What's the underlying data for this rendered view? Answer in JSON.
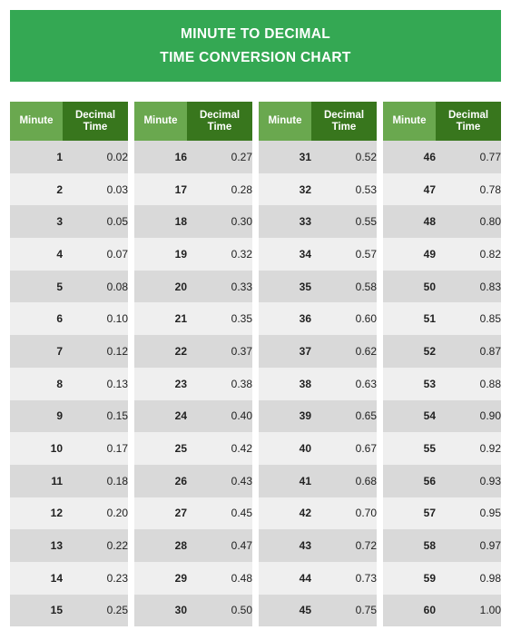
{
  "banner": {
    "title_line1": "MINUTE TO DECIMAL",
    "title_line2": "TIME CONVERSION CHART",
    "background_color": "#34a853",
    "text_color": "#ffffff"
  },
  "theme": {
    "header_minute_color": "#6aa84f",
    "header_decimal_color": "#38761d",
    "row_odd_color": "#d9d9d9",
    "row_even_color": "#efefef",
    "page_background": "#ffffff",
    "cell_text_color": "#222222"
  },
  "columns": {
    "minute_label": "Minute",
    "decimal_label_line1": "Decimal",
    "decimal_label_line2": "Time"
  },
  "chart_data": {
    "type": "table",
    "title": "MINUTE TO DECIMAL TIME CONVERSION CHART",
    "columns": [
      "Minute",
      "Decimal Time"
    ],
    "blocks": [
      {
        "rows": [
          {
            "minute": "1",
            "decimal": "0.02"
          },
          {
            "minute": "2",
            "decimal": "0.03"
          },
          {
            "minute": "3",
            "decimal": "0.05"
          },
          {
            "minute": "4",
            "decimal": "0.07"
          },
          {
            "minute": "5",
            "decimal": "0.08"
          },
          {
            "minute": "6",
            "decimal": "0.10"
          },
          {
            "minute": "7",
            "decimal": "0.12"
          },
          {
            "minute": "8",
            "decimal": "0.13"
          },
          {
            "minute": "9",
            "decimal": "0.15"
          },
          {
            "minute": "10",
            "decimal": "0.17"
          },
          {
            "minute": "11",
            "decimal": "0.18"
          },
          {
            "minute": "12",
            "decimal": "0.20"
          },
          {
            "minute": "13",
            "decimal": "0.22"
          },
          {
            "minute": "14",
            "decimal": "0.23"
          },
          {
            "minute": "15",
            "decimal": "0.25"
          }
        ]
      },
      {
        "rows": [
          {
            "minute": "16",
            "decimal": "0.27"
          },
          {
            "minute": "17",
            "decimal": "0.28"
          },
          {
            "minute": "18",
            "decimal": "0.30"
          },
          {
            "minute": "19",
            "decimal": "0.32"
          },
          {
            "minute": "20",
            "decimal": "0.33"
          },
          {
            "minute": "21",
            "decimal": "0.35"
          },
          {
            "minute": "22",
            "decimal": "0.37"
          },
          {
            "minute": "23",
            "decimal": "0.38"
          },
          {
            "minute": "24",
            "decimal": "0.40"
          },
          {
            "minute": "25",
            "decimal": "0.42"
          },
          {
            "minute": "26",
            "decimal": "0.43"
          },
          {
            "minute": "27",
            "decimal": "0.45"
          },
          {
            "minute": "28",
            "decimal": "0.47"
          },
          {
            "minute": "29",
            "decimal": "0.48"
          },
          {
            "minute": "30",
            "decimal": "0.50"
          }
        ]
      },
      {
        "rows": [
          {
            "minute": "31",
            "decimal": "0.52"
          },
          {
            "minute": "32",
            "decimal": "0.53"
          },
          {
            "minute": "33",
            "decimal": "0.55"
          },
          {
            "minute": "34",
            "decimal": "0.57"
          },
          {
            "minute": "35",
            "decimal": "0.58"
          },
          {
            "minute": "36",
            "decimal": "0.60"
          },
          {
            "minute": "37",
            "decimal": "0.62"
          },
          {
            "minute": "38",
            "decimal": "0.63"
          },
          {
            "minute": "39",
            "decimal": "0.65"
          },
          {
            "minute": "40",
            "decimal": "0.67"
          },
          {
            "minute": "41",
            "decimal": "0.68"
          },
          {
            "minute": "42",
            "decimal": "0.70"
          },
          {
            "minute": "43",
            "decimal": "0.72"
          },
          {
            "minute": "44",
            "decimal": "0.73"
          },
          {
            "minute": "45",
            "decimal": "0.75"
          }
        ]
      },
      {
        "rows": [
          {
            "minute": "46",
            "decimal": "0.77"
          },
          {
            "minute": "47",
            "decimal": "0.78"
          },
          {
            "minute": "48",
            "decimal": "0.80"
          },
          {
            "minute": "49",
            "decimal": "0.82"
          },
          {
            "minute": "50",
            "decimal": "0.83"
          },
          {
            "minute": "51",
            "decimal": "0.85"
          },
          {
            "minute": "52",
            "decimal": "0.87"
          },
          {
            "minute": "53",
            "decimal": "0.88"
          },
          {
            "minute": "54",
            "decimal": "0.90"
          },
          {
            "minute": "55",
            "decimal": "0.92"
          },
          {
            "minute": "56",
            "decimal": "0.93"
          },
          {
            "minute": "57",
            "decimal": "0.95"
          },
          {
            "minute": "58",
            "decimal": "0.97"
          },
          {
            "minute": "59",
            "decimal": "0.98"
          },
          {
            "minute": "60",
            "decimal": "1.00"
          }
        ]
      }
    ]
  }
}
